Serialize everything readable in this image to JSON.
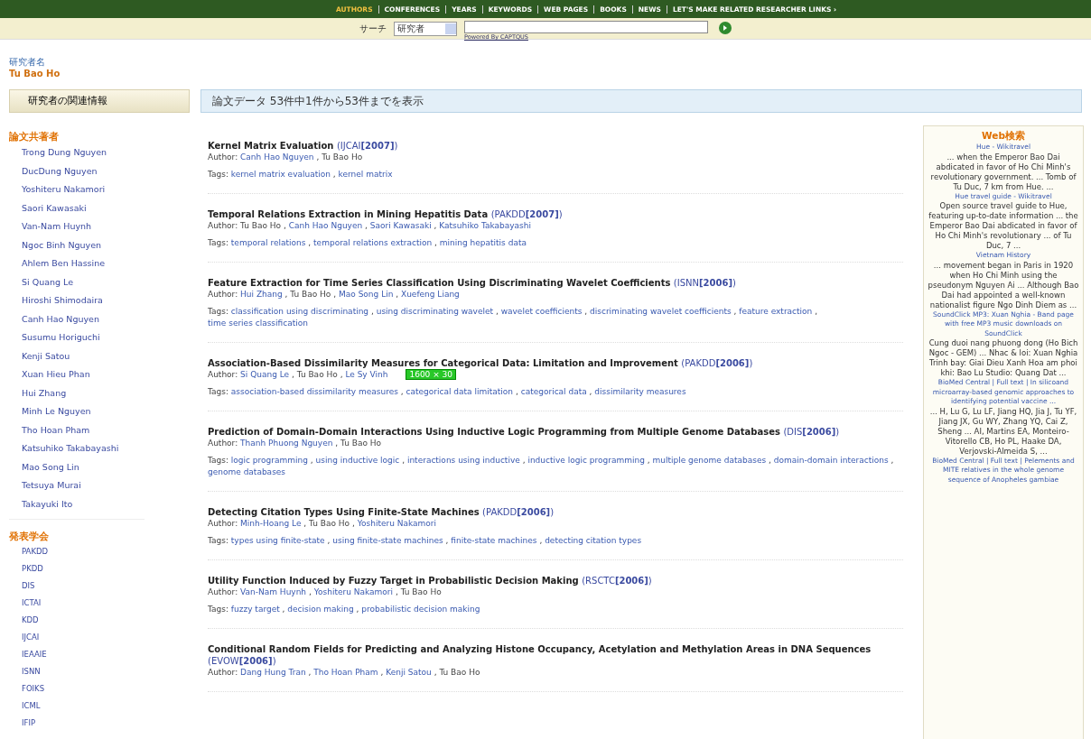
{
  "nav": {
    "items": [
      {
        "label": "AUTHORS",
        "selected": true
      },
      {
        "label": "CONFERENCES",
        "selected": false
      },
      {
        "label": "YEARS",
        "selected": false
      },
      {
        "label": "KEYWORDS",
        "selected": false
      },
      {
        "label": "WEB PAGES",
        "selected": false
      },
      {
        "label": "BOOKS",
        "selected": false
      },
      {
        "label": "NEWS",
        "selected": false
      },
      {
        "label": "LET'S MAKE RELATED RESEARCHER LINKS ›",
        "selected": false
      }
    ]
  },
  "search": {
    "label": "サーチ",
    "select_value": "研究者",
    "powered_by": "Powered By CAPTQUS"
  },
  "researcher": {
    "caption": "研究者名",
    "name": "Tu Bao Ho"
  },
  "related_button": "研究者の関連情報",
  "result_summary": "論文データ 53件中1件から53件までを表示",
  "sidebar": {
    "sections": [
      {
        "heading": "論文共著者",
        "items": [
          "Trong Dung Nguyen",
          "DucDung Nguyen",
          "Yoshiteru Nakamori",
          "Saori Kawasaki",
          "Van-Nam Huynh",
          "Ngoc Binh Nguyen",
          "Ahlem Ben Hassine",
          "Si Quang Le",
          "Hiroshi Shimodaira",
          "Canh Hao Nguyen",
          "Susumu Horiguchi",
          "Kenji Satou",
          "Xuan Hieu Phan",
          "Hui Zhang",
          "Minh Le Nguyen",
          "Tho Hoan Pham",
          "Katsuhiko Takabayashi",
          "Mao Song Lin",
          "Tetsuya Murai",
          "Takayuki Ito"
        ]
      },
      {
        "heading": "発表学会",
        "items": [
          "PAKDD",
          "PKDD",
          "DIS",
          "ICTAI",
          "KDD",
          "IJCAI",
          "IEAAIE",
          "ISNN",
          "FOIKS",
          "ICML",
          "IFIP"
        ]
      }
    ]
  },
  "papers": [
    {
      "title": "Kernel Matrix Evaluation",
      "venue": "(IJCAI**[2007]**)",
      "author_label": "Author:",
      "authors": [
        {
          "name": "Canh Hao Nguyen",
          "linked": true,
          "separator": ","
        },
        {
          "name": "Tu Bao Ho",
          "linked": false
        }
      ],
      "tags_label": "Tags:",
      "tags": [
        {
          "text": "kernel matrix evaluation",
          "separator": ","
        },
        {
          "text": "kernel matrix"
        }
      ]
    },
    {
      "title": "Temporal Relations Extraction in Mining Hepatitis Data",
      "venue": "(PAKDD**[2007]**)",
      "author_label": "Author:",
      "authors": [
        {
          "name": "Tu Bao Ho",
          "linked": false,
          "separator": ","
        },
        {
          "name": "Canh Hao Nguyen",
          "linked": true,
          "separator": ","
        },
        {
          "name": "Saori Kawasaki",
          "linked": true,
          "separator": ","
        },
        {
          "name": "Katsuhiko Takabayashi",
          "linked": true
        }
      ],
      "tags_label": "Tags:",
      "tags": [
        {
          "text": "temporal relations",
          "separator": ","
        },
        {
          "text": "temporal relations extraction",
          "separator": ","
        },
        {
          "text": "mining hepatitis data"
        }
      ]
    },
    {
      "title": "Feature Extraction for Time Series Classification Using Discriminating Wavelet Coefficients",
      "venue": "(ISNN**[2006]**)",
      "author_label": "Author:",
      "authors": [
        {
          "name": "Hui Zhang",
          "linked": true,
          "separator": ","
        },
        {
          "name": "Tu Bao Ho",
          "linked": false,
          "separator": ","
        },
        {
          "name": "Mao Song Lin",
          "linked": true,
          "separator": ","
        },
        {
          "name": "Xuefeng Liang",
          "linked": true
        }
      ],
      "tags_label": "Tags:",
      "tags": [
        {
          "text": "classification using discriminating",
          "separator": ","
        },
        {
          "text": "using discriminating wavelet",
          "separator": ","
        },
        {
          "text": "wavelet coefficients",
          "separator": ","
        },
        {
          "text": "discriminating wavelet coefficients",
          "separator": ","
        },
        {
          "text": "feature extraction",
          "separator": ","
        },
        {
          "text": "time series classification"
        }
      ]
    },
    {
      "title": "Association-Based Dissimilarity Measures for Categorical Data: Limitation and Improvement",
      "venue": "(PAKDD**[2006]**)",
      "author_label": "Author:",
      "authors": [
        {
          "name": "Si Quang Le",
          "linked": true,
          "separator": ","
        },
        {
          "name": "Tu Bao Ho",
          "linked": false,
          "separator": ","
        },
        {
          "name": "Le Sy Vinh",
          "linked": true
        }
      ],
      "overlay": "1600 × 30",
      "tags_label": "Tags:",
      "tags": [
        {
          "text": "association-based dissimilarity measures",
          "separator": ","
        },
        {
          "text": "categorical data limitation",
          "separator": ","
        },
        {
          "text": "categorical data",
          "separator": ","
        },
        {
          "text": "dissimilarity measures"
        }
      ]
    },
    {
      "title": "Prediction of Domain-Domain Interactions Using Inductive Logic Programming from Multiple Genome Databases",
      "venue": "(DIS**[2006]**)",
      "author_label": "Author:",
      "authors": [
        {
          "name": "Thanh Phuong Nguyen",
          "linked": true,
          "separator": ","
        },
        {
          "name": "Tu Bao Ho",
          "linked": false
        }
      ],
      "tags_label": "Tags:",
      "tags": [
        {
          "text": "logic programming",
          "separator": ","
        },
        {
          "text": "using inductive logic",
          "separator": ","
        },
        {
          "text": "interactions using inductive",
          "separator": ","
        },
        {
          "text": "inductive logic programming",
          "separator": ","
        },
        {
          "text": "multiple genome databases",
          "separator": ","
        },
        {
          "text": "domain-domain interactions",
          "separator": ","
        },
        {
          "text": "genome databases"
        }
      ]
    },
    {
      "title": "Detecting Citation Types Using Finite-State Machines",
      "venue": "(PAKDD**[2006]**)",
      "author_label": "Author:",
      "authors": [
        {
          "name": "Minh-Hoang Le",
          "linked": true,
          "separator": ","
        },
        {
          "name": "Tu Bao Ho",
          "linked": false,
          "separator": ","
        },
        {
          "name": "Yoshiteru Nakamori",
          "linked": true
        }
      ],
      "tags_label": "Tags:",
      "tags": [
        {
          "text": "types using finite-state",
          "separator": ","
        },
        {
          "text": "using finite-state machines",
          "separator": ","
        },
        {
          "text": "finite-state machines",
          "separator": ","
        },
        {
          "text": "detecting citation types"
        }
      ]
    },
    {
      "title": "Utility Function Induced by Fuzzy Target in Probabilistic Decision Making",
      "venue": "(RSCTC**[2006]**)",
      "author_label": "Author:",
      "authors": [
        {
          "name": "Van-Nam Huynh",
          "linked": true,
          "separator": ","
        },
        {
          "name": "Yoshiteru Nakamori",
          "linked": true,
          "separator": ","
        },
        {
          "name": "Tu Bao Ho",
          "linked": false
        }
      ],
      "tags_label": "Tags:",
      "tags": [
        {
          "text": "fuzzy target",
          "separator": ","
        },
        {
          "text": "decision making",
          "separator": ","
        },
        {
          "text": "probabilistic decision making"
        }
      ]
    },
    {
      "title": "Conditional Random Fields for Predicting and Analyzing Histone Occupancy, Acetylation and Methylation Areas in DNA Sequences",
      "venue": "(EVOW**[2006]**)",
      "author_label": "Author:",
      "authors": [
        {
          "name": "Dang Hung Tran",
          "linked": true,
          "separator": ","
        },
        {
          "name": "Tho Hoan Pham",
          "linked": true,
          "separator": ","
        },
        {
          "name": "Kenji Satou",
          "linked": true,
          "separator": ","
        },
        {
          "name": "Tu Bao Ho",
          "linked": false
        }
      ]
    }
  ],
  "web_search": {
    "title": "Web検索",
    "results": [
      {
        "title": "Hue - Wikitravel",
        "snippet": "... when the Emperor Bao Dai abdicated in favor of Ho Chi Minh's revolutionary government. ... Tomb of Tu Duc, 7 km from Hue. ..."
      },
      {
        "title": "Hue travel guide - Wikitravel",
        "snippet": "Open source travel guide to Hue, featuring up-to-date information ... the Emperor Bao Dai abdicated in favor of Ho Chi Minh's revolutionary ... of Tu Duc, 7 ..."
      },
      {
        "title": "Vietnam History",
        "snippet": "... movement began in Paris in 1920 when Ho Chi Minh using the pseudonym Nguyen Ai ... Although Bao Dai had appointed a well-known nationalist figure Ngo Dinh Diem as ..."
      },
      {
        "title": "SoundClick MP3: Xuan Nghia - Band page with free MP3 music downloads on SoundClick",
        "snippet": "Cung duoi nang phuong dong (Ho Bich Ngoc - GEM) ... Nhac & loi: Xuan Nghia Trinh bay: Giai Dieu Xanh Hoa am phoi khi: Bao Lu Studio: Quang Dat ..."
      },
      {
        "title": "BioMed Central | Full text | In silicoand microarray-based genomic approaches to identifying potential vaccine ...",
        "snippet": "... H, Lu G, Lu LF, Jiang HQ, Jia J, Tu YF, Jiang JX, Gu WY, Zhang YQ, Cai Z, Sheng ... AI, Martins EA, Monteiro-Vitorello CB, Ho PL, Haake DA, Verjovski-Almeida S, ..."
      },
      {
        "title": "BioMed Central | Full text | Pelements and MITE relatives in the whole genome sequence of Anopheles gambiae"
      }
    ]
  }
}
